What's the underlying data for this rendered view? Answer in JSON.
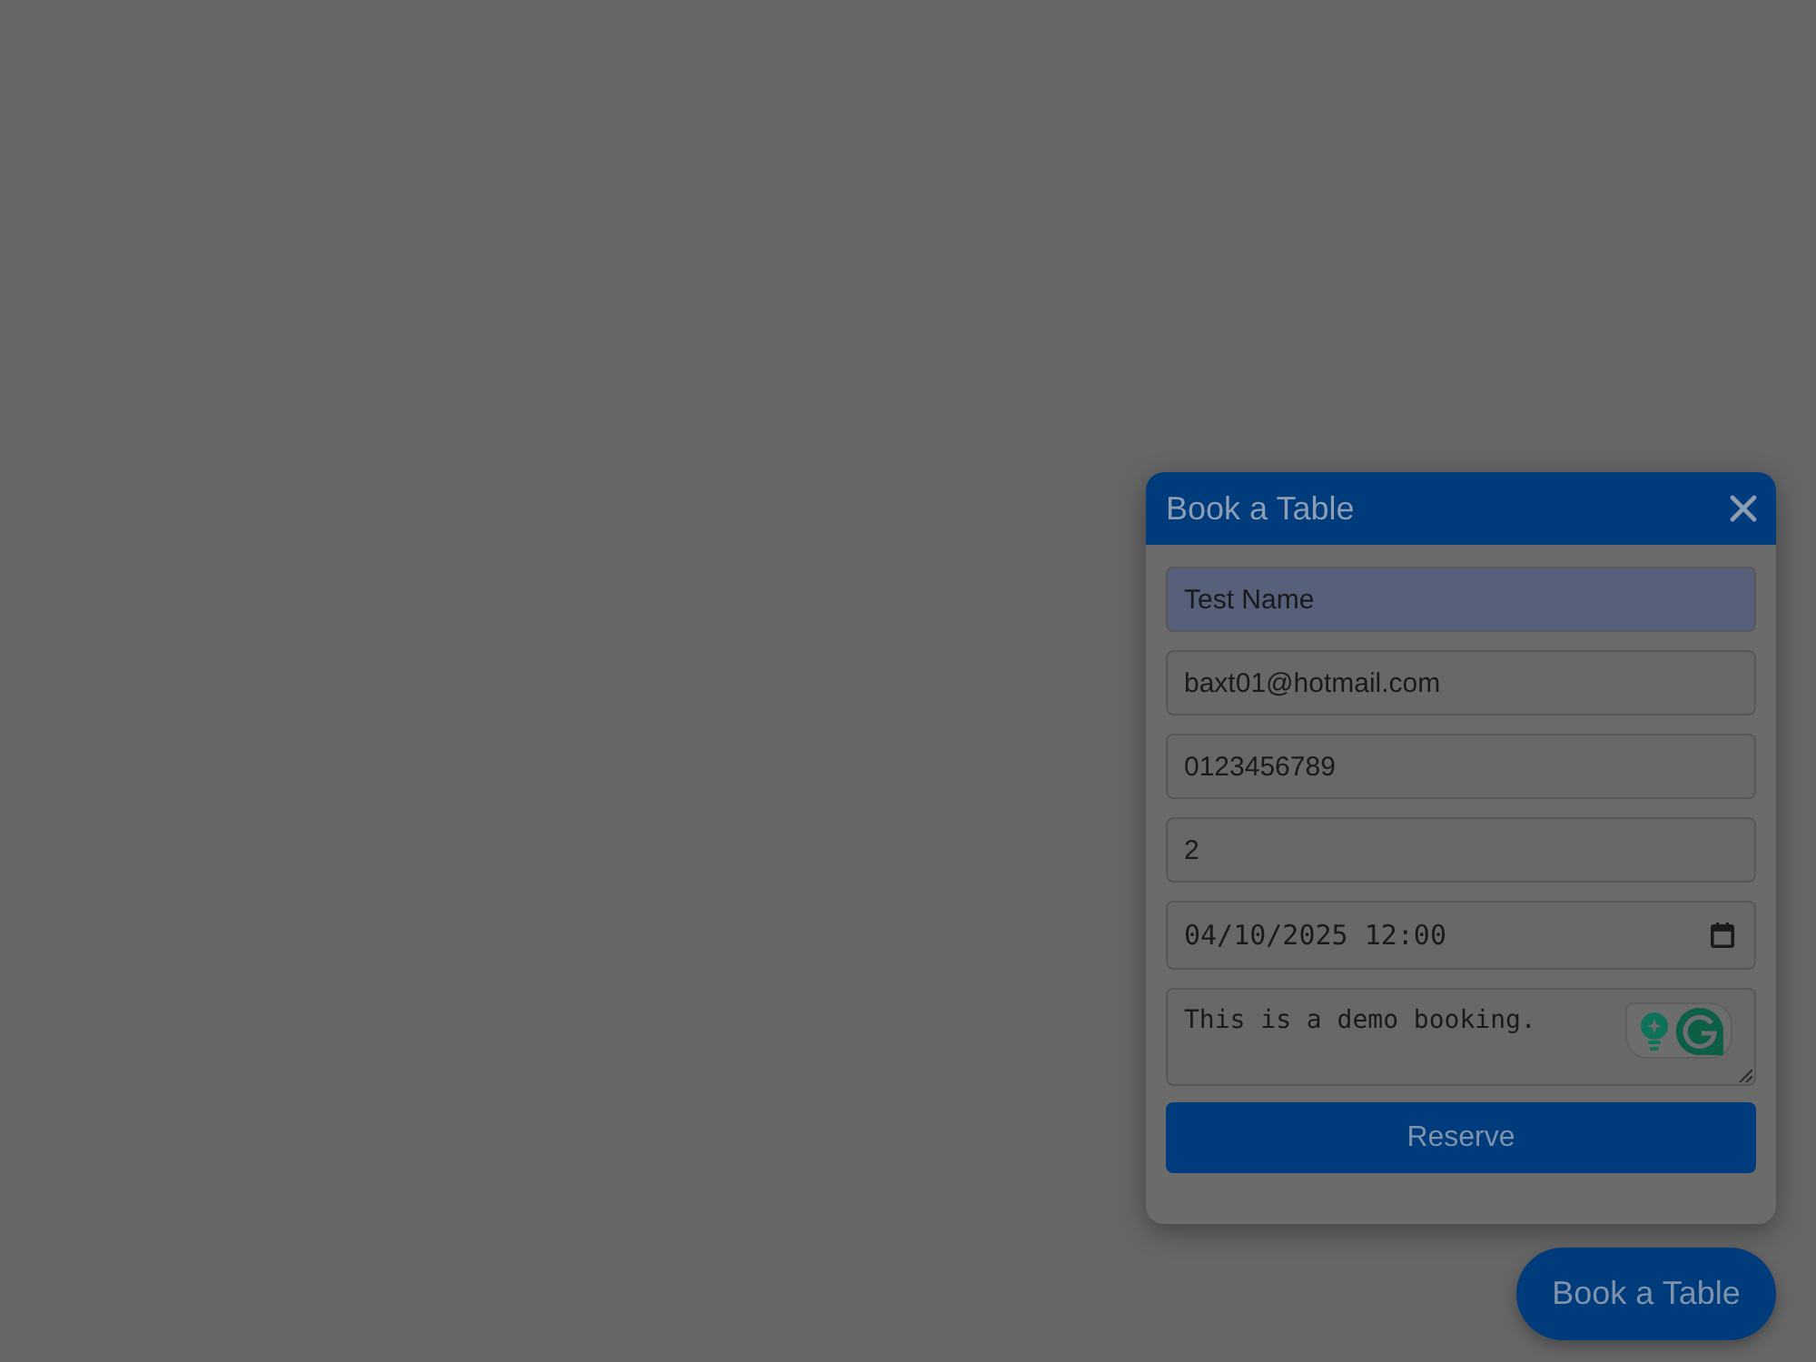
{
  "modal": {
    "title": "Book a Table",
    "fields": [
      {
        "kind": "text",
        "value": "Test Name",
        "autofilled": true
      },
      {
        "kind": "text",
        "value": "baxt01@hotmail.com",
        "autofilled": false
      },
      {
        "kind": "text",
        "value": "0123456789",
        "autofilled": false
      },
      {
        "kind": "text",
        "value": "2",
        "autofilled": false
      },
      {
        "kind": "datetime",
        "value": "04/10/2025 12:00",
        "autofilled": false
      },
      {
        "kind": "textarea",
        "value": "This is a demo booking.",
        "autofilled": false
      }
    ],
    "submit": "Reserve"
  },
  "launcher": {
    "label": "Book a Table"
  }
}
